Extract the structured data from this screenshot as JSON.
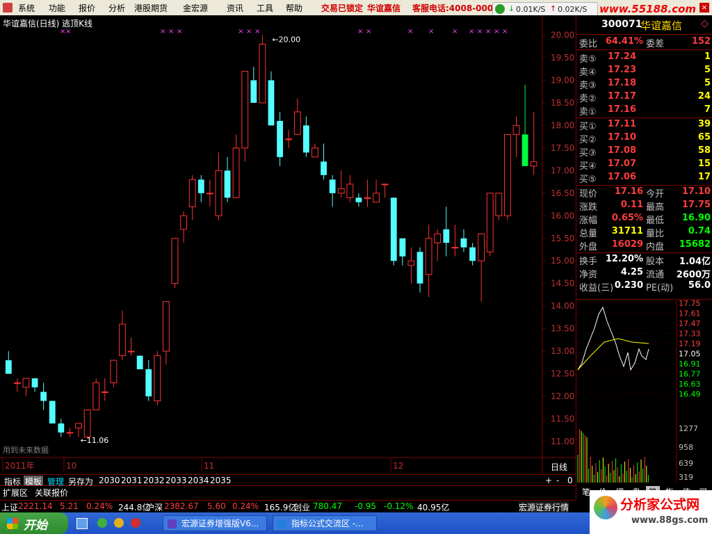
{
  "menu": {
    "items": [
      "系统",
      "功能",
      "报价",
      "分析",
      "港股期货",
      "金宏源",
      "资讯",
      "工具",
      "帮助"
    ],
    "trade_status": "交易已锁定",
    "stock_short": "华谊嘉信",
    "hotline": "客服电话:4008-000"
  },
  "net_speed": {
    "down": "0.01K/S",
    "up": "0.02K/S"
  },
  "site_banner": "www.55188.com",
  "chart": {
    "title": "华谊嘉信(日线) 逃顶K线",
    "period_label": "日线",
    "future_data_note": "用到未来数据",
    "max_label": "20.00",
    "min_label": "11.06",
    "date_labels": [
      "2011年",
      "10",
      "11",
      "12"
    ],
    "y_ticks": [
      "20.00",
      "19.50",
      "19.00",
      "18.50",
      "18.00",
      "17.50",
      "17.00",
      "16.50",
      "16.00",
      "15.50",
      "15.00",
      "14.50",
      "14.00",
      "13.50",
      "13.00",
      "12.50",
      "12.00",
      "11.50",
      "11.00"
    ]
  },
  "chart_data": {
    "type": "candlestick",
    "ylim": [
      10.8,
      20.1
    ],
    "candles": [
      [
        12.8,
        13.0,
        12.5,
        12.5
      ],
      [
        12.3,
        12.4,
        12.1,
        12.3
      ],
      [
        12.2,
        12.4,
        12.0,
        12.4
      ],
      [
        12.4,
        12.4,
        12.1,
        12.2
      ],
      [
        12.1,
        12.3,
        11.7,
        11.9
      ],
      [
        11.9,
        11.9,
        11.4,
        11.4
      ],
      [
        11.4,
        11.5,
        11.1,
        11.2
      ],
      [
        11.2,
        11.3,
        11.1,
        11.2
      ],
      [
        11.3,
        11.3,
        11.1,
        11.4
      ],
      [
        11.1,
        11.7,
        11.06,
        11.7
      ],
      [
        11.7,
        12.4,
        11.7,
        12.3
      ],
      [
        12.1,
        12.4,
        11.9,
        12.1
      ],
      [
        12.3,
        12.8,
        12.2,
        12.8
      ],
      [
        12.9,
        13.9,
        12.8,
        13.6
      ],
      [
        13.0,
        13.3,
        12.9,
        13.0
      ],
      [
        12.9,
        12.9,
        12.6,
        12.6
      ],
      [
        12.6,
        12.8,
        11.9,
        12.0
      ],
      [
        11.9,
        13.0,
        11.8,
        12.9
      ],
      [
        13.0,
        14.1,
        12.7,
        14.1
      ],
      [
        14.5,
        15.5,
        14.4,
        15.5
      ],
      [
        15.7,
        16.1,
        15.4,
        16.0
      ],
      [
        16.2,
        16.9,
        15.9,
        16.8
      ],
      [
        16.8,
        16.9,
        16.3,
        16.5
      ],
      [
        16.5,
        16.8,
        16.2,
        16.5
      ],
      [
        16.0,
        17.4,
        15.9,
        17.0
      ],
      [
        17.0,
        17.3,
        16.3,
        16.4
      ],
      [
        16.4,
        17.8,
        16.4,
        17.5
      ],
      [
        17.5,
        19.0,
        17.2,
        19.2
      ],
      [
        19.0,
        19.3,
        18.8,
        18.5
      ],
      [
        18.5,
        20.0,
        18.6,
        19.8
      ],
      [
        19.0,
        19.2,
        18.5,
        18.0
      ],
      [
        18.1,
        18.3,
        17.1,
        17.3
      ],
      [
        17.7,
        17.9,
        17.5,
        17.7
      ],
      [
        17.8,
        18.6,
        17.8,
        18.3
      ],
      [
        18.0,
        18.2,
        17.3,
        17.4
      ],
      [
        17.3,
        17.6,
        17.3,
        17.5
      ],
      [
        17.2,
        17.6,
        16.8,
        16.9
      ],
      [
        16.8,
        16.9,
        16.2,
        16.5
      ],
      [
        16.5,
        17.0,
        16.4,
        16.6
      ],
      [
        16.4,
        16.9,
        16.3,
        16.7
      ],
      [
        16.4,
        16.5,
        16.2,
        16.3
      ],
      [
        16.4,
        16.8,
        16.2,
        16.4
      ],
      [
        16.3,
        16.8,
        16.3,
        16.5
      ],
      [
        16.7,
        16.7,
        16.4,
        16.7
      ],
      [
        16.4,
        16.4,
        14.9,
        15.0
      ],
      [
        15.5,
        15.5,
        14.9,
        15.1
      ],
      [
        14.9,
        15.3,
        14.5,
        15.0
      ],
      [
        15.2,
        15.3,
        14.3,
        14.5
      ],
      [
        14.7,
        15.8,
        14.2,
        15.5
      ],
      [
        15.4,
        15.7,
        15.0,
        15.6
      ],
      [
        15.7,
        16.2,
        15.1,
        15.4
      ],
      [
        15.3,
        15.8,
        15.1,
        15.3
      ],
      [
        15.5,
        15.7,
        15.2,
        15.3
      ],
      [
        15.3,
        15.4,
        14.9,
        15.0
      ],
      [
        15.0,
        15.6,
        14.1,
        15.6
      ],
      [
        15.2,
        16.3,
        15.1,
        16.5
      ],
      [
        16.0,
        16.4,
        15.9,
        16.5
      ],
      [
        16.0,
        17.0,
        15.9,
        17.8
      ],
      [
        17.8,
        18.2,
        17.3,
        18.0
      ],
      [
        17.8,
        18.9,
        17.1,
        17.1
      ],
      [
        17.1,
        18.3,
        16.9,
        17.2
      ]
    ]
  },
  "quote": {
    "code": "300071",
    "name": "华谊嘉信",
    "weibi_label": "委比",
    "weibi": "64.41%",
    "weicha_label": "委差",
    "weicha": "152",
    "asks": [
      {
        "label": "卖⑤",
        "price": "17.24",
        "vol": "1"
      },
      {
        "label": "卖④",
        "price": "17.23",
        "vol": "5"
      },
      {
        "label": "卖③",
        "price": "17.18",
        "vol": "5"
      },
      {
        "label": "卖②",
        "price": "17.17",
        "vol": "24"
      },
      {
        "label": "卖①",
        "price": "17.16",
        "vol": "7"
      }
    ],
    "bids": [
      {
        "label": "买①",
        "price": "17.11",
        "vol": "39"
      },
      {
        "label": "买②",
        "price": "17.10",
        "vol": "65"
      },
      {
        "label": "买③",
        "price": "17.08",
        "vol": "58"
      },
      {
        "label": "买④",
        "price": "17.07",
        "vol": "15"
      },
      {
        "label": "买⑤",
        "price": "17.06",
        "vol": "17"
      }
    ],
    "stats": [
      {
        "l1": "现价",
        "v1": "17.16",
        "c1": "red",
        "l2": "今开",
        "v2": "17.10",
        "c2": "red"
      },
      {
        "l1": "涨跌",
        "v1": "0.11",
        "c1": "red",
        "l2": "最高",
        "v2": "17.75",
        "c2": "red"
      },
      {
        "l1": "涨幅",
        "v1": "0.65%",
        "c1": "red",
        "l2": "最低",
        "v2": "16.90",
        "c2": "green"
      },
      {
        "l1": "总量",
        "v1": "31711",
        "c1": "yellow",
        "l2": "量比",
        "v2": "0.74",
        "c2": "green"
      },
      {
        "l1": "外盘",
        "v1": "16029",
        "c1": "red",
        "l2": "内盘",
        "v2": "15682",
        "c2": "green"
      }
    ],
    "fund": [
      {
        "l1": "换手",
        "v1": "12.20%",
        "l2": "股本",
        "v2": "1.04亿"
      },
      {
        "l1": "净资",
        "v1": "4.25",
        "l2": "流通",
        "v2": "2600万"
      },
      {
        "l1": "收益(三)",
        "v1": "0.230",
        "l2": "PE(动)",
        "v2": "56.0"
      }
    ]
  },
  "mini_chart": {
    "price_ticks": [
      "17.75",
      "17.61",
      "17.47",
      "17.33",
      "17.19",
      "17.05",
      "16.91",
      "16.77",
      "16.63",
      "16.49"
    ],
    "vol_ticks": [
      "1277",
      "958",
      "639",
      "319"
    ],
    "tabs": [
      "笔",
      "价",
      "细",
      "盘",
      "势",
      "指",
      "值",
      "买"
    ]
  },
  "bottom_tabs": [
    "指标",
    "模板",
    "管理",
    "另存为",
    "2030",
    "2031",
    "2032",
    "2033",
    "2034",
    "2035"
  ],
  "nav_buttons": [
    "+",
    "-",
    "0"
  ],
  "ext_tabs": [
    "扩展区",
    "关联报价"
  ],
  "status": {
    "sh_label": "上证",
    "sh_val": "2221.14",
    "sh_chg": "5.21",
    "sh_pct": "0.24%",
    "sh_amt": "244.8亿",
    "sz_label": "沪深",
    "sz_val": "2382.67",
    "sz_chg": "5.60",
    "sz_pct": "0.24%",
    "sz_amt": "165.9亿",
    "cy_label": "创业",
    "cy_val": "780.47",
    "cy_chg": "-0.95",
    "cy_pct": "-0.12%",
    "cy_amt": "40.95亿",
    "broker": "宏源证券行情"
  },
  "taskbar": {
    "start": "开始",
    "tasks": [
      "宏源证券增强版V6...",
      "指标公式交流区 -..."
    ]
  },
  "watermark": {
    "text": "分析家公式网",
    "url": "www.88gs.com"
  }
}
